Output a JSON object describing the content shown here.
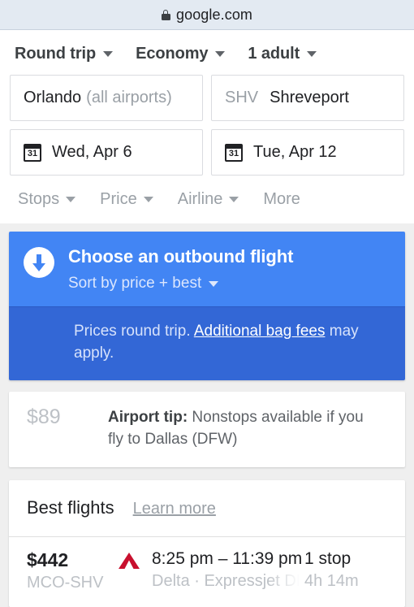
{
  "browser": {
    "url": "google.com",
    "lock_icon": "lock-icon"
  },
  "search": {
    "options": [
      {
        "label": "Round trip",
        "icon": "chevron-down-icon"
      },
      {
        "label": "Economy",
        "icon": "chevron-down-icon"
      },
      {
        "label": "1 adult",
        "icon": "chevron-down-icon"
      }
    ],
    "origin": {
      "primary": "Orlando",
      "secondary": "(all airports)"
    },
    "destination": {
      "code": "SHV",
      "primary": "Shreveport"
    },
    "depart_date": {
      "icon": "calendar-icon",
      "icon_day": "31",
      "label": "Wed, Apr 6"
    },
    "return_date": {
      "icon": "calendar-icon",
      "icon_day": "31",
      "label": "Tue, Apr 12"
    },
    "filters": [
      {
        "label": "Stops",
        "has_caret": true
      },
      {
        "label": "Price",
        "has_caret": true
      },
      {
        "label": "Airline",
        "has_caret": true
      },
      {
        "label": "More",
        "has_caret": false
      }
    ]
  },
  "banner": {
    "icon": "download-arrow-icon",
    "title": "Choose an outbound flight",
    "sort_label": "Sort by price + best",
    "sort_icon": "chevron-down-icon",
    "notice_prefix": "Prices round trip. ",
    "notice_link": "Additional bag fees",
    "notice_suffix": " may apply.",
    "color_top": "#4285f4",
    "color_bottom": "#3367d6"
  },
  "airport_tip": {
    "price": "$89",
    "label": "Airport tip:",
    "text": " Nonstops available if you fly to Dallas (DFW)"
  },
  "best_flights": {
    "title": "Best flights",
    "learn_more": "Learn more",
    "rows": [
      {
        "price": "$442",
        "route": "MCO-SHV",
        "airline_logo": "delta-logo-icon",
        "times": "8:25 pm – 11:39 pm",
        "airline": "Delta · Expressjet DBA Delta Connection",
        "stops": "1 stop",
        "duration": "4h 14m"
      }
    ]
  }
}
